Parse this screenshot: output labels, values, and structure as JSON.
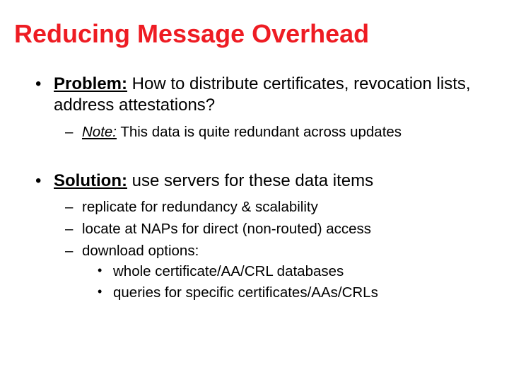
{
  "title": "Reducing Message Overhead",
  "bullets": {
    "problem": {
      "label": "Problem:",
      "text": " How to distribute certificates, revocation lists, address attestations?",
      "note_label": "Note:",
      "note_text": " This data is quite redundant across updates"
    },
    "solution": {
      "label": "Solution:",
      "text": " use servers for these data items",
      "subs": {
        "s0": "replicate for redundancy & scalability",
        "s1": "locate at NAPs for direct (non-routed) access",
        "s2": "download options:",
        "s2_subs": {
          "a": "whole certificate/AA/CRL databases",
          "b": "queries for specific certificates/AAs/CRLs"
        }
      }
    }
  }
}
